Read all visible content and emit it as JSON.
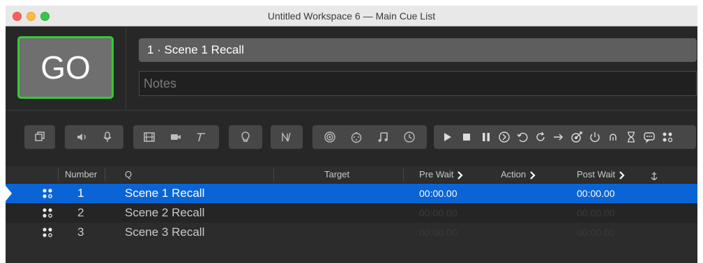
{
  "window": {
    "title": "Untitled Workspace 6 — Main Cue List"
  },
  "go_button": {
    "label": "GO"
  },
  "cue_name_field": {
    "value": "1 · Scene 1 Recall"
  },
  "notes_field": {
    "placeholder": "Notes"
  },
  "toolbar_groups": [
    [
      "group-icon"
    ],
    [
      "audio-icon",
      "mic-icon"
    ],
    [
      "video-icon",
      "camera-icon",
      "text-icon"
    ],
    [
      "light-icon"
    ],
    [
      "fade-icon"
    ],
    [
      "network-icon",
      "midi-icon",
      "music-icon",
      "timecode-icon"
    ],
    [
      "start-icon",
      "stop-icon",
      "pause-icon",
      "load-icon",
      "reset-icon",
      "devamp-icon",
      "goto-icon",
      "target-icon",
      "arm-icon",
      "disarm-icon",
      "wait-icon",
      "memo-icon",
      "script-icon"
    ]
  ],
  "table": {
    "headers": {
      "number": "Number",
      "q": "Q",
      "target": "Target",
      "pre_wait": "Pre Wait",
      "action": "Action",
      "post_wait": "Post Wait"
    },
    "rows": [
      {
        "number": "1",
        "name": "Scene 1 Recall",
        "pre_wait": "00:00.00",
        "post_wait": "00:00.00",
        "selected": true,
        "icon": "lighting-cue-icon"
      },
      {
        "number": "2",
        "name": "Scene 2 Recall",
        "pre_wait": "00:00.00",
        "post_wait": "00:00.00",
        "selected": false,
        "icon": "lighting-cue-icon"
      },
      {
        "number": "3",
        "name": "Scene 3 Recall",
        "pre_wait": "00:00.00",
        "post_wait": "00:00.00",
        "selected": false,
        "icon": "lighting-cue-icon"
      }
    ]
  },
  "colors": {
    "go_border": "#33cc33",
    "selection": "#0a64d6"
  }
}
